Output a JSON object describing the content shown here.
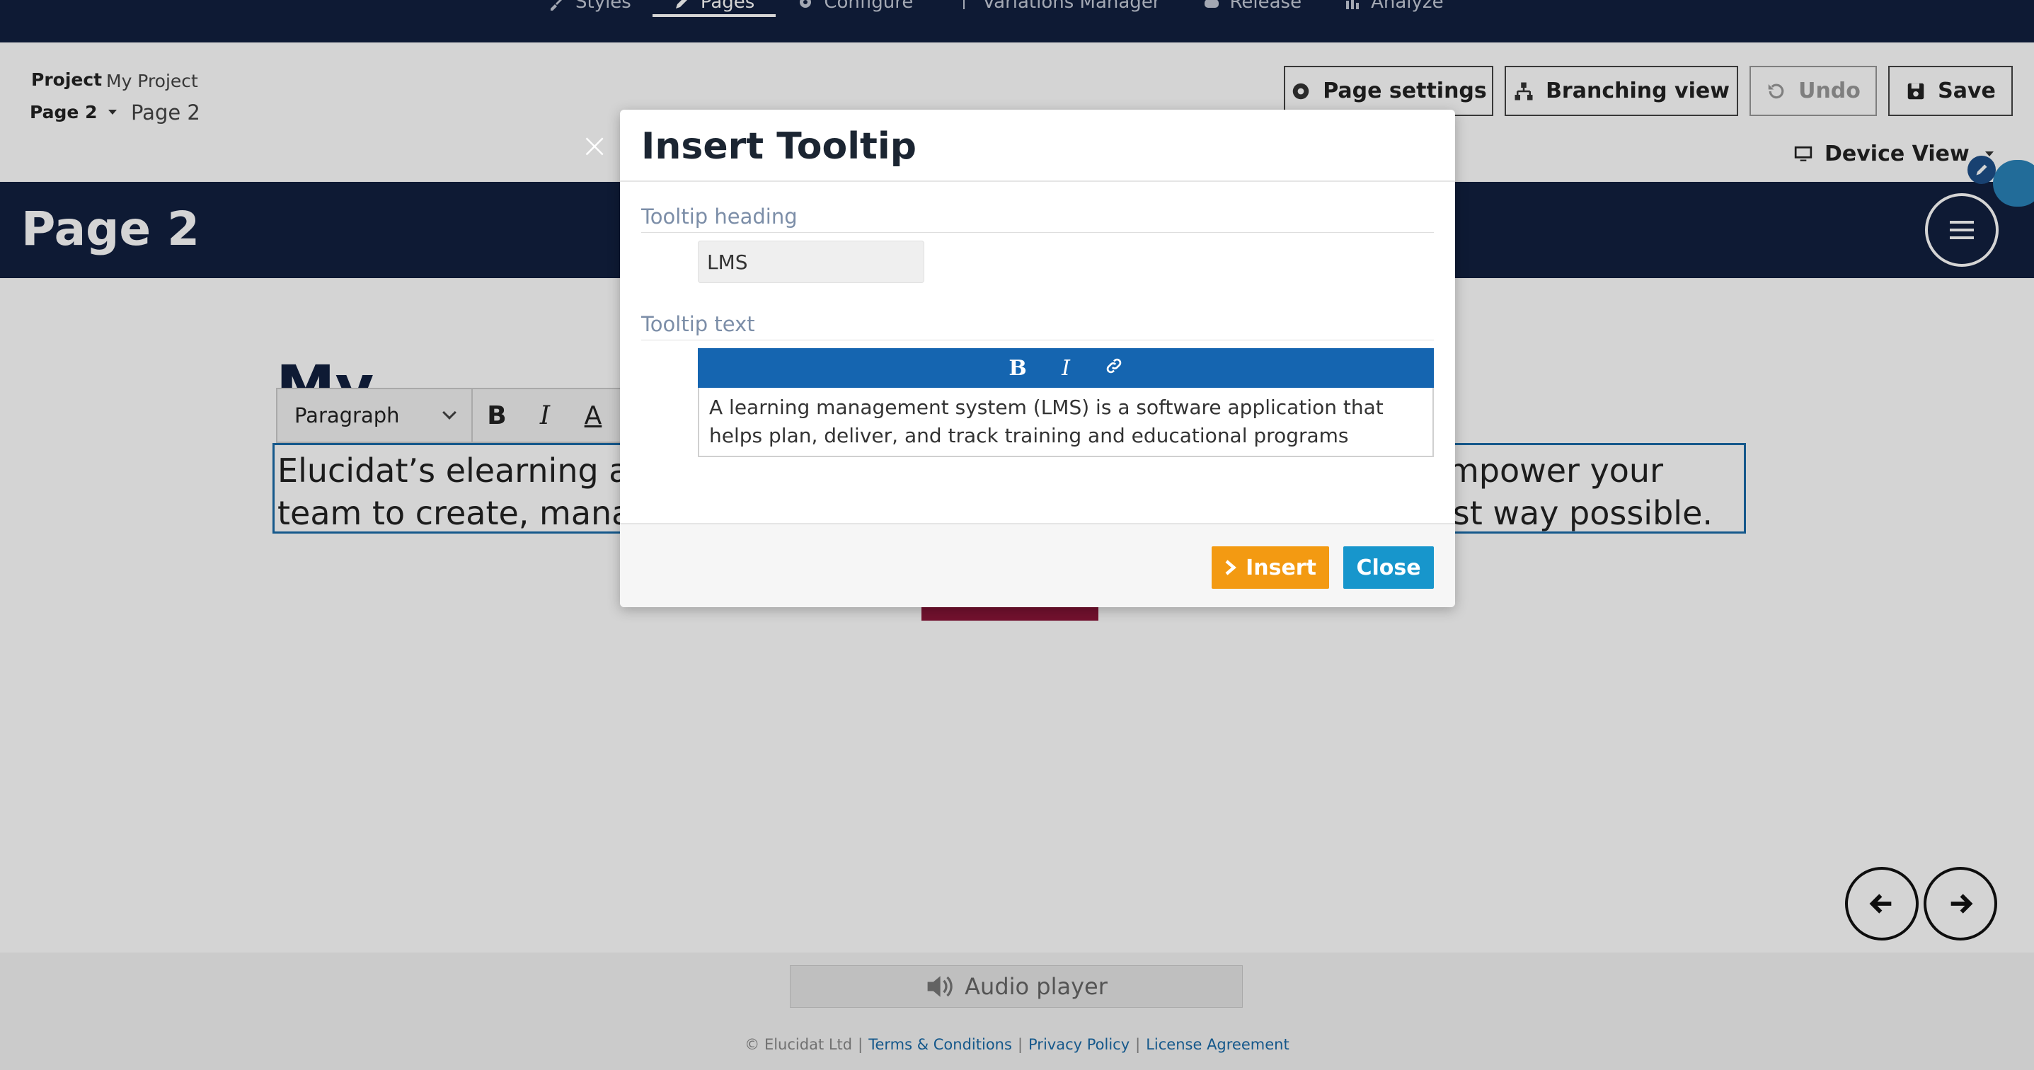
{
  "topnav": {
    "tabs": [
      {
        "label": "Styles",
        "icon": "brush-icon"
      },
      {
        "label": "Pages",
        "icon": "pencil-icon",
        "active": true
      },
      {
        "label": "Configure",
        "icon": "gear-icon"
      },
      {
        "label": "Variations Manager",
        "icon": "fork-icon"
      },
      {
        "label": "Release",
        "icon": "cloud-icon"
      },
      {
        "label": "Analyze",
        "icon": "bar-chart-icon"
      }
    ]
  },
  "header": {
    "project_label": "Project",
    "project_name": "My Project",
    "page_select": "Page 2",
    "page_name": "Page 2",
    "buttons": {
      "page_settings": "Page settings",
      "branching_view": "Branching view",
      "undo": "Undo",
      "save": "Save"
    },
    "device_view": "Device View"
  },
  "page": {
    "title": "Page 2",
    "heading": "My Project",
    "paragraph_style": "Paragraph",
    "paragraph_line1_left": "Elucidat’s elearning aut",
    "paragraph_line1_right": "empower your",
    "paragraph_line2_left": "team to create, manag",
    "paragraph_line2_right": "est way possible."
  },
  "footer": {
    "audio_player": "Audio player",
    "copyright": "© Elucidat Ltd",
    "links": [
      "Terms & Conditions",
      "Privacy Policy",
      "License Agreement"
    ]
  },
  "modal": {
    "title": "Insert Tooltip",
    "heading_label": "Tooltip heading",
    "heading_value": "LMS",
    "text_label": "Tooltip text",
    "text_toolbar": [
      "B",
      "I",
      "link-icon"
    ],
    "text_value": "A learning management system (LMS) is a software application that helps plan, deliver, and track training and educational programs",
    "insert_label": "Insert",
    "close_label": "Close"
  },
  "colors": {
    "nav_bg": "#12203f",
    "accent_blue": "#1565b0",
    "insert_orange": "#f39a12",
    "close_blue": "#1796cc",
    "maroon": "#8a1538"
  }
}
